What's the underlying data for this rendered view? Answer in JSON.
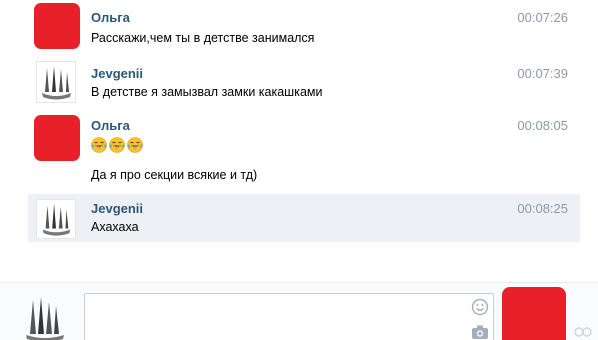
{
  "conversation": {
    "messages": [
      {
        "author": "Ольга",
        "time": "00:07:26",
        "lines": [
          "Расскажи,чем ты в детстве занимался"
        ]
      },
      {
        "author": "Jevgenii",
        "time": "00:07:39",
        "lines": [
          "В детстве я замызвал замки какашками"
        ]
      },
      {
        "author": "Ольга",
        "time": "00:08:05",
        "emojis": [
          "face-with-tears-of-joy",
          "face-with-tears-of-joy",
          "face-with-tears-of-joy"
        ],
        "lines": [
          "Да я про секции всякие и тд)"
        ]
      },
      {
        "author": "Jevgenii",
        "time": "00:08:25",
        "lines": [
          "Ахахаха"
        ]
      }
    ]
  },
  "composer": {
    "message_value": "",
    "icons": [
      "smile-icon",
      "camera-icon"
    ]
  },
  "colors": {
    "author": "#2b587a",
    "time": "#8b99a8",
    "highlight": "#edf1f5",
    "avatar_red": "#e8202a"
  }
}
